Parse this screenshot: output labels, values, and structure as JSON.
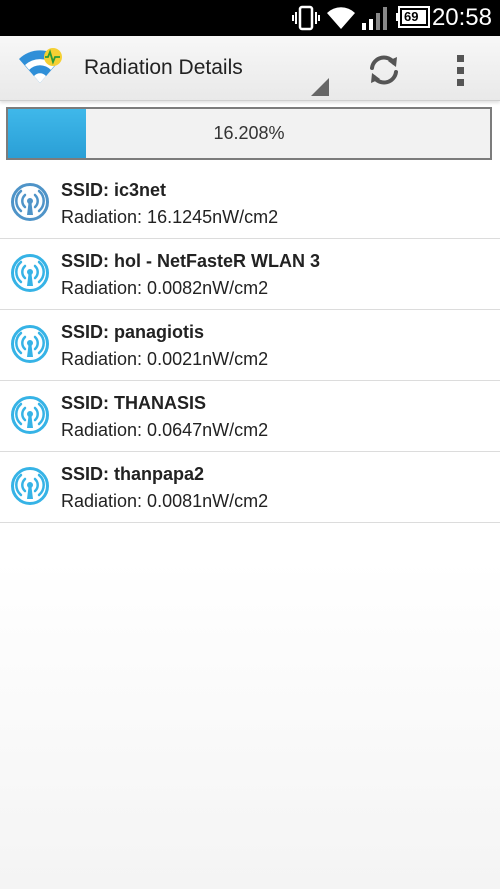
{
  "status_bar": {
    "time": "20:58",
    "battery": "69"
  },
  "action_bar": {
    "title": "Radiation Details",
    "refresh_icon": "refresh-icon",
    "overflow_icon": "overflow-menu-icon",
    "app_icon": "wifi-radiation-app-icon"
  },
  "progress": {
    "value": 16.208,
    "label": "16.208%",
    "fill_color": "#33ade2"
  },
  "networks": [
    {
      "ssid": "SSID: ic3net",
      "radiation": "Radiation: 16.1245nW/cm2",
      "icon_color": "#4f94c8"
    },
    {
      "ssid": "SSID: hol - NetFasteR WLAN 3",
      "radiation": "Radiation: 0.0082nW/cm2",
      "icon_color": "#36b3e6"
    },
    {
      "ssid": "SSID: panagiotis",
      "radiation": "Radiation: 0.0021nW/cm2",
      "icon_color": "#36b3e6"
    },
    {
      "ssid": "SSID: THANASIS",
      "radiation": "Radiation: 0.0647nW/cm2",
      "icon_color": "#36b3e6"
    },
    {
      "ssid": "SSID: thanpapa2",
      "radiation": "Radiation: 0.0081nW/cm2",
      "icon_color": "#36b3e6"
    }
  ]
}
